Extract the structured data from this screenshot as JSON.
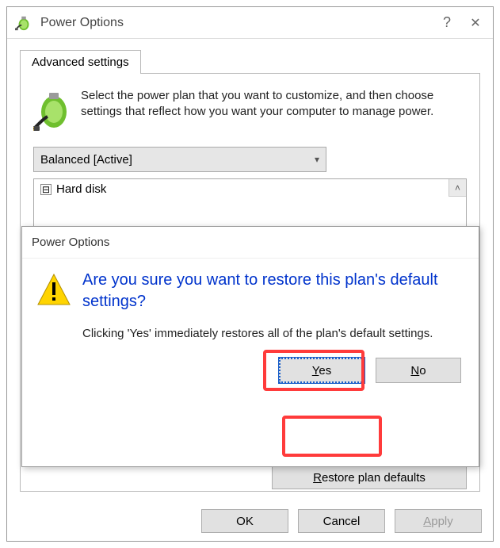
{
  "window": {
    "title": "Power Options",
    "help_label": "?",
    "close_label": "✕"
  },
  "tab": {
    "label": "Advanced settings"
  },
  "intro": "Select the power plan that you want to customize, and then choose settings that reflect how you want your computer to manage power.",
  "plan_select": {
    "value": "Balanced [Active]"
  },
  "tree": {
    "toggle_glyph": "⊟",
    "item0": "Hard disk",
    "scroll_chevron": "˄"
  },
  "restore_label": "estore plan defaults",
  "restore_mnemonic": "R",
  "footer": {
    "ok": "OK",
    "cancel": "Cancel",
    "apply_mnemonic": "A",
    "apply_rest": "pply"
  },
  "dialog": {
    "title": "Power Options",
    "heading": "Are you sure you want to restore this plan's default settings?",
    "body": "Clicking 'Yes' immediately restores all of the plan's default settings.",
    "yes_mnemonic": "Y",
    "yes_rest": "es",
    "no_mnemonic": "N",
    "no_rest": "o"
  }
}
